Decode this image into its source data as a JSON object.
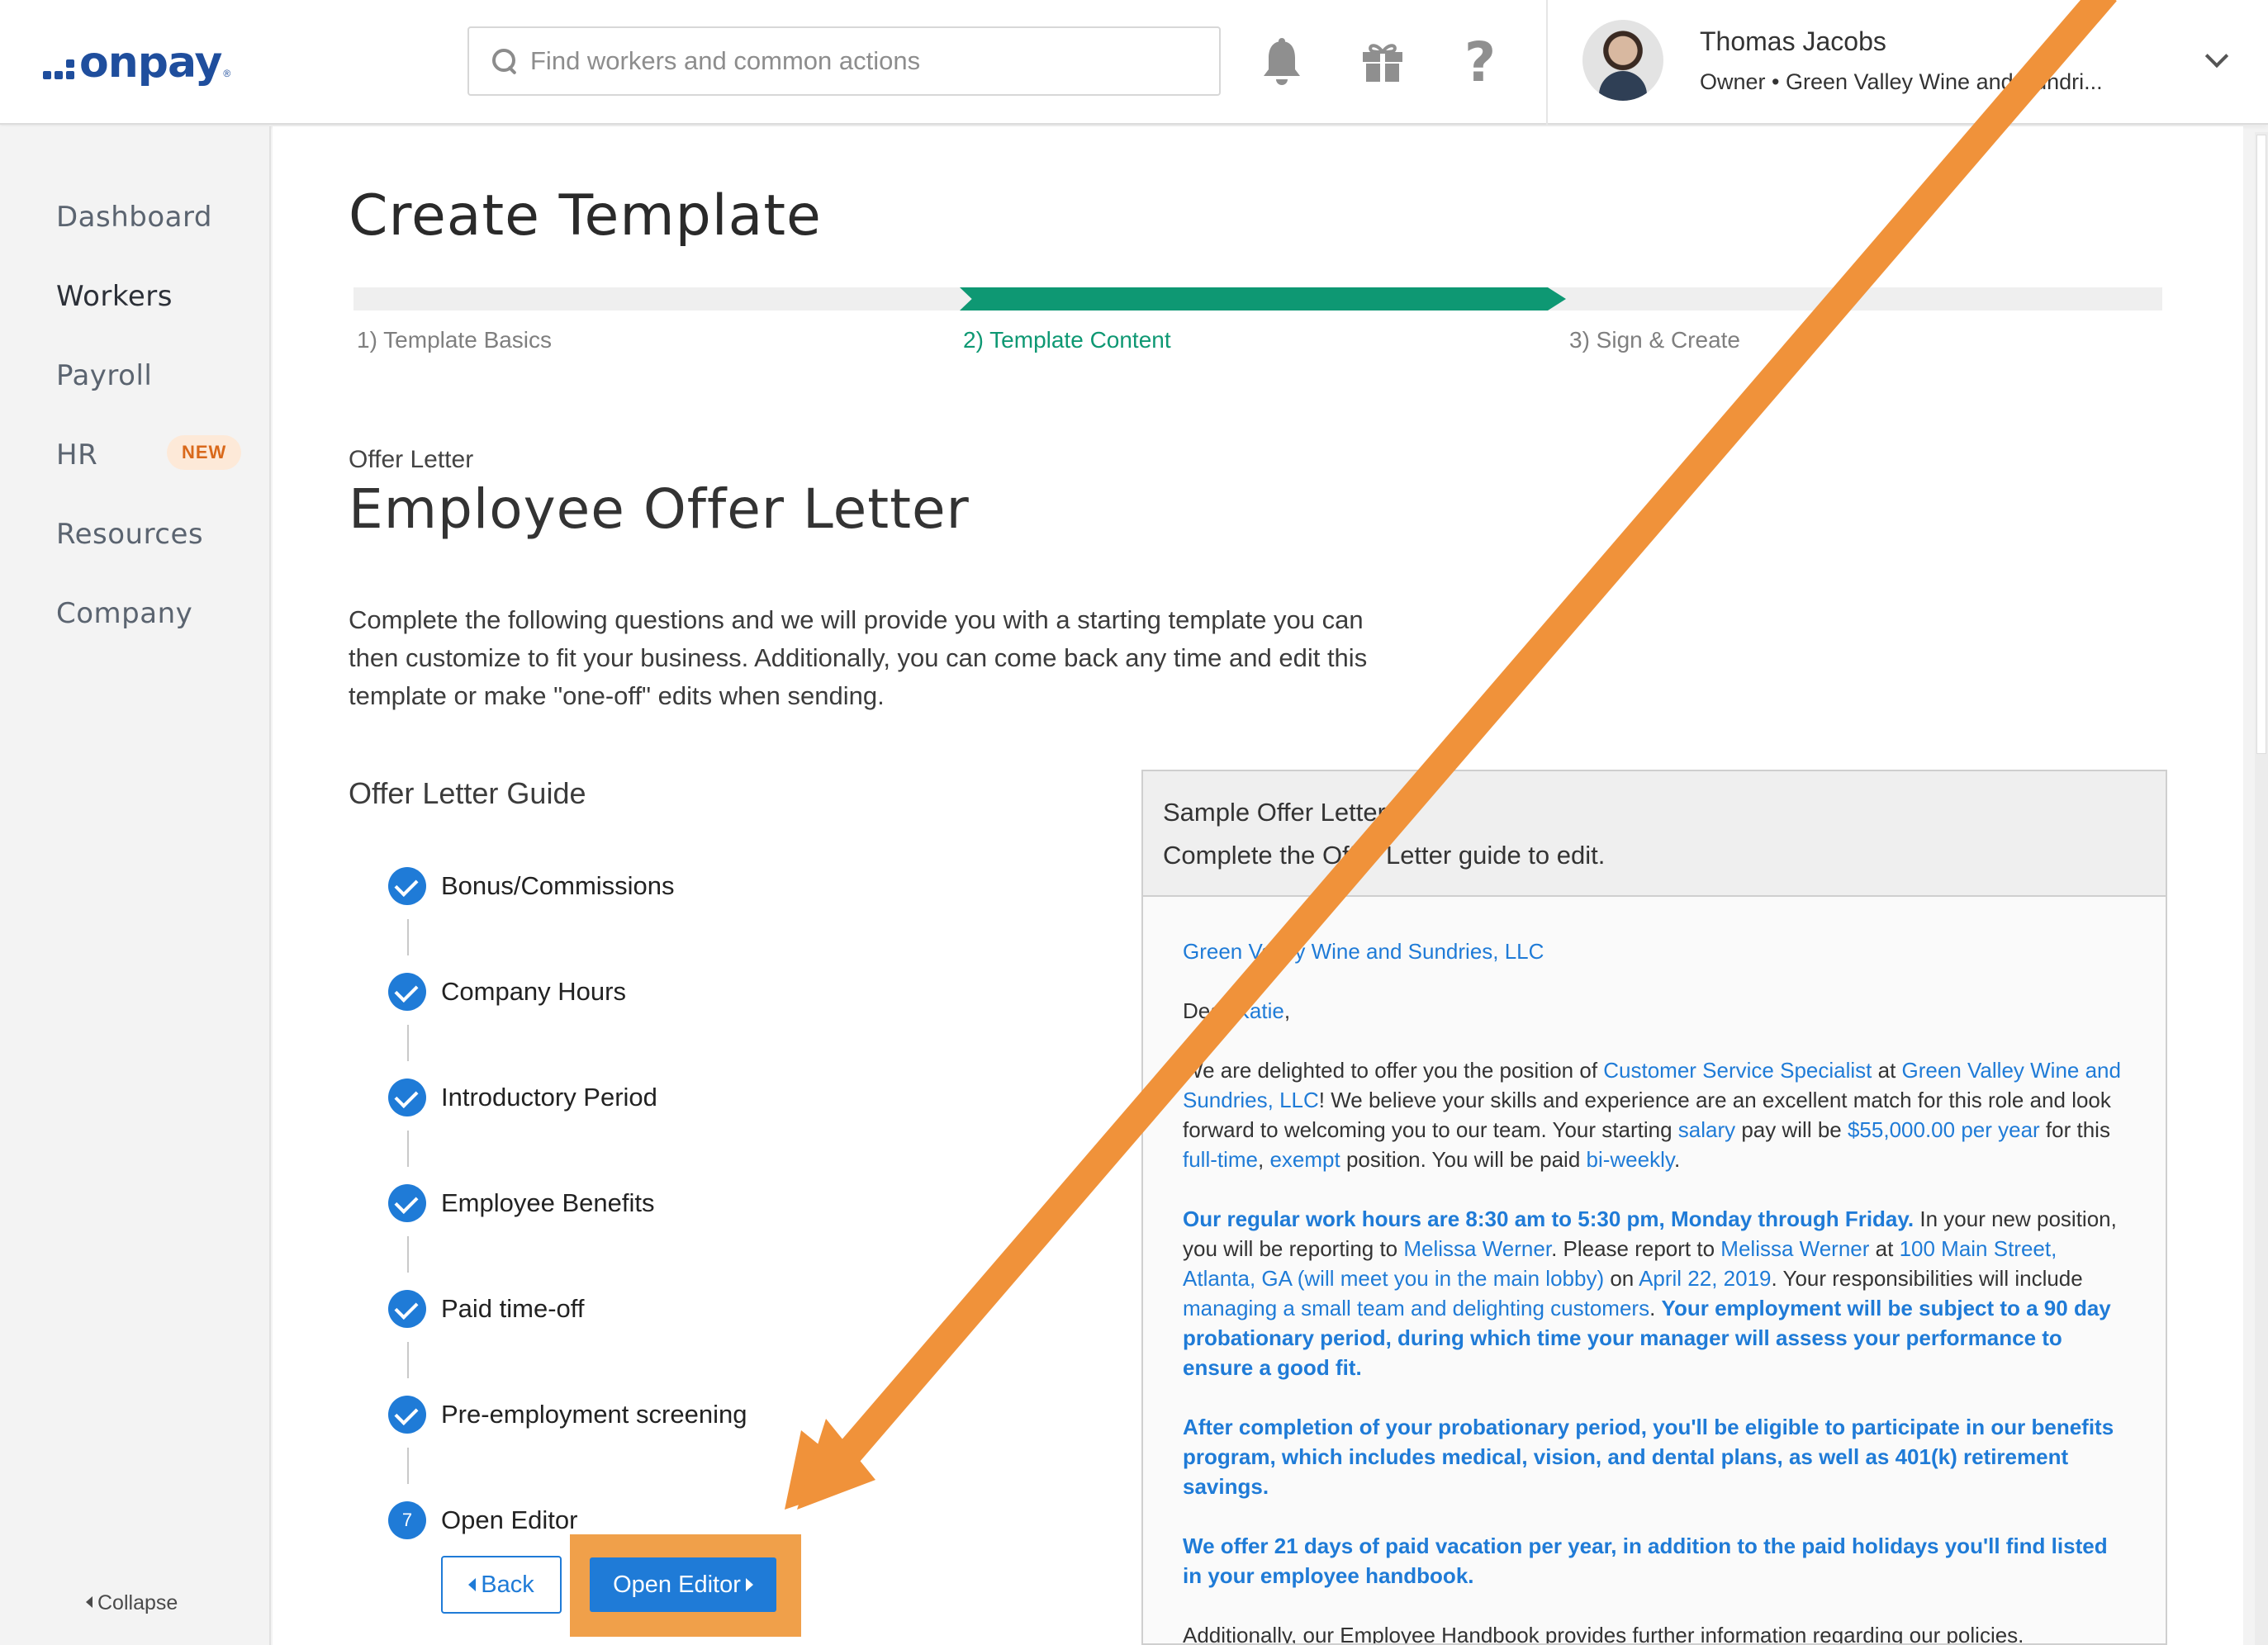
{
  "brand": {
    "logo_text": "onpay",
    "logo_reg": "®",
    "accent": "#1f7bd7",
    "green": "#0e9873",
    "annotation": "#f0923a"
  },
  "header": {
    "search_placeholder": "Find workers and common actions",
    "icons": [
      "search-icon",
      "bell-icon",
      "gift-icon",
      "help-icon"
    ],
    "help_glyph": "?",
    "user_name": "Thomas Jacobs",
    "user_role": "Owner • Green Valley Wine and Sundri..."
  },
  "sidebar": {
    "items": [
      {
        "label": "Dashboard"
      },
      {
        "label": "Workers"
      },
      {
        "label": "Payroll"
      },
      {
        "label": "HR",
        "badge": "NEW"
      },
      {
        "label": "Resources"
      },
      {
        "label": "Company"
      }
    ],
    "collapse_label": "Collapse"
  },
  "main": {
    "title": "Create Template",
    "steps": [
      {
        "label": "1) Template Basics"
      },
      {
        "label": "2) Template Content"
      },
      {
        "label": "3) Sign & Create"
      }
    ],
    "doc_type": "Offer Letter",
    "doc_title": "Employee Offer Letter",
    "intro": "Complete the following questions and we will provide you with a starting template you can then customize to fit your business. Additionally, you can come back any time and edit this template or make \"one-off\" edits when sending.",
    "guide_title": "Offer Letter Guide",
    "guide_items": [
      {
        "label": "Bonus/Commissions"
      },
      {
        "label": "Company Hours"
      },
      {
        "label": "Introductory Period"
      },
      {
        "label": "Employee Benefits"
      },
      {
        "label": "Paid time-off"
      },
      {
        "label": "Pre-employment screening"
      },
      {
        "label": "Open Editor",
        "number": "7"
      }
    ],
    "back_label": "Back",
    "open_editor_label": "Open Editor"
  },
  "sample": {
    "title": "Sample Offer Letter",
    "subtitle": "Complete the Offer Letter guide to edit.",
    "company": "Green Valley Wine and Sundries, LLC",
    "greeting_1": "Dear ",
    "greeting_name": "Katie",
    "greeting_2": ",",
    "p1": {
      "t1": "We are delighted to offer you the position of ",
      "position": "Customer Service Specialist",
      "t2": " at ",
      "company": "Green Valley Wine and Sundries, LLC",
      "t3": "! We believe your skills and experience are an excellent match for this role and look forward to welcoming you to our team. Your starting ",
      "pay_type": "salary",
      "t4": " pay will be ",
      "pay": "$55,000.00 per year",
      "t5": " for this ",
      "fulltime": "full-time",
      "t6": ", ",
      "exempt": "exempt",
      "t7": " position. You will be paid ",
      "freq": "bi-weekly",
      "t8": "."
    },
    "p2": {
      "hours": "Our regular work hours are 8:30 am to 5:30 pm, Monday through Friday.",
      "t1": " In your new position, you will be reporting to ",
      "manager": "Melissa Werner",
      "t2": ". Please report to ",
      "manager2": "Melissa Werner",
      "t3": " at ",
      "location": "100 Main Street, Atlanta, GA (will meet you in the main lobby)",
      "t4": " on ",
      "date": "April 22, 2019",
      "t5": ". Your responsibilities will include ",
      "duties": "managing a small team and delighting customers",
      "t6": ". ",
      "probation": "Your employment will be subject to a 90 day probationary period, during which time your manager will assess your performance to ensure a good fit."
    },
    "p3": "After completion of your probationary period, you'll be eligible to participate in our benefits program, which includes medical, vision, and dental plans, as well as 401(k) retirement savings.",
    "p4": "We offer 21 days of paid vacation per year, in addition to the paid holidays you'll find listed in your employee handbook.",
    "p5": "Additionally, our Employee Handbook provides further information regarding our policies."
  }
}
